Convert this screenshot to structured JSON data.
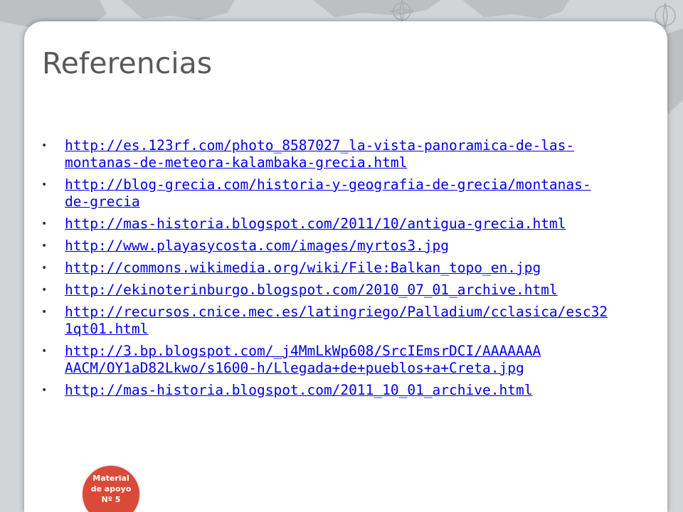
{
  "slide": {
    "title": "Referencias",
    "references": [
      "http://es.123rf.com/photo_8587027_la-vista-panoramica-de-las-\nmontanas-de-meteora-kalambaka-grecia.html",
      "http://blog-grecia.com/historia-y-geografia-de-grecia/montanas-\nde-grecia",
      "http://mas-historia.blogspot.com/2011/10/antigua-grecia.html",
      "http://www.playasycosta.com/images/myrtos3.jpg",
      "http://commons.wikimedia.org/wiki/File:Balkan_topo_en.jpg",
      "http://ekinoterinburgo.blogspot.com/2010_07_01_archive.html",
      "http://recursos.cnice.mec.es/latingriego/Palladium/cclasica/esc32\n1qt01.html",
      "http://3.bp.blogspot.com/_j4MmLkWp608/SrcIEmsrDCI/AAAAAAA\nAACM/OY1aD82Lkwo/s1600-h/Llegada+de+pueblos+a+Creta.jpg",
      "http://mas-historia.blogspot.com/2011_10_01_archive.html"
    ],
    "bullet_char": "•"
  },
  "badge": {
    "line1": "Material",
    "line2": "de apoyo",
    "line3": "Nº 5"
  },
  "colors": {
    "background": "#d2d5d7",
    "card": "#ffffff",
    "title": "#595959",
    "link": "#0000ee",
    "badge": "#d94a38"
  },
  "icons": {
    "background": "world-map-decoration",
    "compass": "compass-rose-icon"
  }
}
